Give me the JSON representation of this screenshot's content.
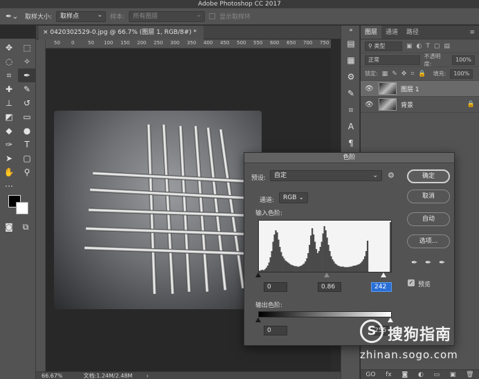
{
  "app": {
    "title": "Adobe Photoshop CC 2017"
  },
  "options_bar": {
    "sample_size_label": "取样大小:",
    "sample_size_value": "取样点",
    "sample_label": "样本:",
    "sample_value": "所有图层",
    "show_ring_label": "显示取样环"
  },
  "document": {
    "tab_title": "0420302529-0.jpg @ 66.7% (图层 1, RGB/8#) *",
    "ruler_ticks": [
      "50",
      "0",
      "50",
      "100",
      "150",
      "200",
      "250",
      "300",
      "350",
      "400",
      "450",
      "500",
      "550",
      "600",
      "650",
      "700",
      "750"
    ]
  },
  "status": {
    "zoom": "66.67%",
    "doc_size": "文档:1.24M/2.48M",
    "arrow": "›"
  },
  "layers_panel": {
    "tabs": [
      "图层",
      "通道",
      "路径"
    ],
    "filter_kind": "类型",
    "blend_mode": "正常",
    "opacity_label": "不透明度:",
    "opacity_value": "100%",
    "lock_label": "锁定:",
    "fill_label": "填充:",
    "fill_value": "100%",
    "layers": [
      {
        "name": "图层 1",
        "locked": false
      },
      {
        "name": "背景",
        "locked": true
      }
    ],
    "footer_icons": [
      "GO",
      "fx"
    ]
  },
  "levels_dialog": {
    "title": "色阶",
    "preset_label": "预设:",
    "preset_value": "自定",
    "channel_label": "通道:",
    "channel_value": "RGB",
    "input_label": "输入色阶:",
    "input_black": "0",
    "input_gamma": "0.86",
    "input_white": "242",
    "output_label": "输出色阶:",
    "output_black": "0",
    "output_white": "255",
    "buttons": {
      "ok": "确定",
      "cancel": "取消",
      "auto": "自动",
      "options": "选项..."
    },
    "preview_label": "预览",
    "preview_checked": true,
    "histogram": [
      2,
      3,
      4,
      3,
      5,
      8,
      12,
      18,
      28,
      40,
      58,
      72,
      80,
      76,
      62,
      48,
      38,
      30,
      26,
      22,
      20,
      18,
      16,
      14,
      13,
      12,
      11,
      11,
      10,
      10,
      11,
      12,
      14,
      16,
      20,
      26,
      36,
      52,
      70,
      84,
      72,
      58,
      44,
      36,
      40,
      48,
      58,
      74,
      88,
      80,
      66,
      52,
      40,
      30,
      24,
      20,
      16,
      14,
      12,
      11,
      10,
      10,
      10,
      9,
      9,
      9,
      9,
      10,
      10,
      11,
      12,
      12,
      13,
      14,
      15,
      17,
      20,
      24,
      30,
      40,
      60,
      0,
      0,
      0,
      0,
      0,
      0,
      0,
      0,
      0,
      0,
      0,
      0,
      0,
      0,
      0,
      0,
      96
    ]
  },
  "watermark": {
    "logo_char": "S",
    "brand": "搜狗指南",
    "url": "zhinan.sogo.com"
  }
}
